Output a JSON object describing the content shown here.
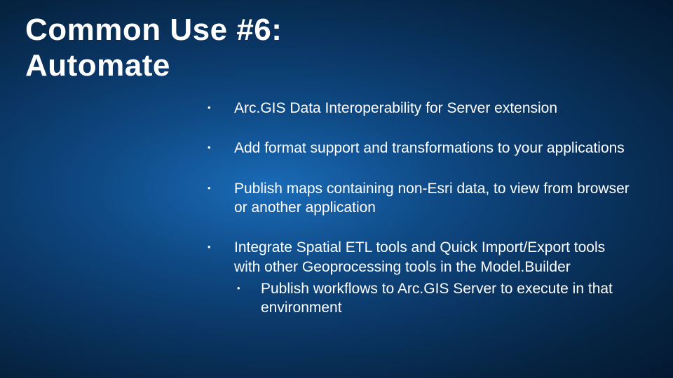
{
  "slide": {
    "title_line1": "Common Use #6:",
    "title_line2": "Automate",
    "bullets": [
      {
        "text": "Arc.GIS Data Interoperability for Server extension"
      },
      {
        "text": "Add format support and transformations to your applications"
      },
      {
        "text": "Publish maps containing non-Esri data, to view from browser or another application"
      },
      {
        "text": "Integrate Spatial ETL tools and Quick Import/Export tools with other Geoprocessing tools in the Model.Builder",
        "sub": [
          {
            "text": "Publish workflows to Arc.GIS Server to execute in that environment"
          }
        ]
      }
    ],
    "bullet_symbol": "•"
  }
}
